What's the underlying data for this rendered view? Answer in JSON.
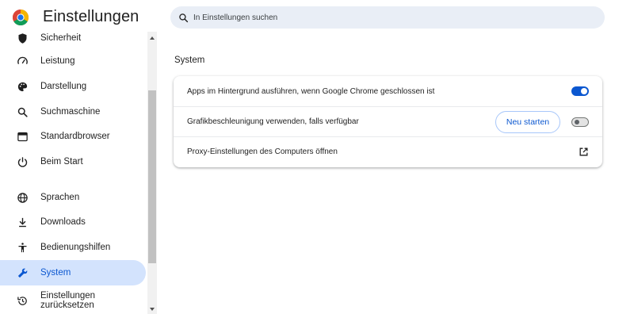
{
  "header": {
    "title": "Einstellungen",
    "logo_icon": "chrome-logo-icon",
    "search_icon": "search-icon",
    "search_placeholder": "In Einstellungen suchen"
  },
  "sidebar": {
    "items": [
      {
        "label": "Sicherheit",
        "icon": "shield-icon"
      },
      {
        "label": "Leistung",
        "icon": "speedometer-icon"
      },
      {
        "label": "Darstellung",
        "icon": "palette-icon"
      },
      {
        "label": "Suchmaschine",
        "icon": "search-icon"
      },
      {
        "label": "Standardbrowser",
        "icon": "browser-window-icon"
      },
      {
        "label": "Beim Start",
        "icon": "power-icon"
      },
      {
        "label": "Sprachen",
        "icon": "globe-icon"
      },
      {
        "label": "Downloads",
        "icon": "download-icon"
      },
      {
        "label": "Bedienungshilfen",
        "icon": "accessibility-icon"
      },
      {
        "label": "System",
        "icon": "wrench-icon",
        "active": true
      },
      {
        "label": "Einstellungen zurücksetzen",
        "label_line1": "Einstellungen",
        "label_line2": "zurücksetzen",
        "icon": "reset-history-icon"
      }
    ]
  },
  "main": {
    "section_title": "System",
    "rows": [
      {
        "label": "Apps im Hintergrund ausführen, wenn Google Chrome geschlossen ist",
        "control": "toggle",
        "enabled": true
      },
      {
        "label": "Grafikbeschleunigung verwenden, falls verfügbar",
        "control": "toggle",
        "enabled": false,
        "button_label": "Neu starten"
      },
      {
        "label": "Proxy-Einstellungen des Computers öffnen",
        "control": "external-link",
        "icon": "open-in-new-icon"
      }
    ]
  },
  "colors": {
    "accent": "#0b57d0",
    "active_nav_bg": "#d3e3fd",
    "search_bg": "#e9eef6"
  }
}
